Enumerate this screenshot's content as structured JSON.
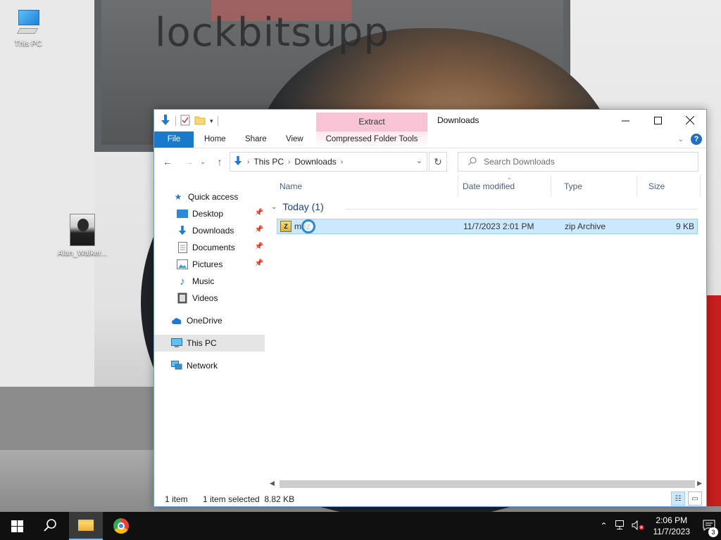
{
  "wallpaper": {
    "overlay_text": "lockbitsupp"
  },
  "desktop": {
    "icons": [
      {
        "label": "This PC"
      },
      {
        "label": "Alan_Walker..."
      }
    ]
  },
  "window": {
    "title": "Downloads",
    "context_tab_group": "Extract",
    "ribbon_tabs": {
      "file": "File",
      "home": "Home",
      "share": "Share",
      "view": "View",
      "context": "Compressed Folder Tools"
    },
    "address": {
      "segments": [
        "This PC",
        "Downloads"
      ]
    },
    "search": {
      "placeholder": "Search Downloads",
      "value": ""
    },
    "nav_pane": {
      "items": [
        {
          "label": "Quick access",
          "icon": "star-icon"
        },
        {
          "label": "Desktop",
          "icon": "desktop-icon",
          "pinned": true
        },
        {
          "label": "Downloads",
          "icon": "download-icon",
          "pinned": true
        },
        {
          "label": "Documents",
          "icon": "document-icon",
          "pinned": true
        },
        {
          "label": "Pictures",
          "icon": "picture-icon",
          "pinned": true
        },
        {
          "label": "Music",
          "icon": "music-icon"
        },
        {
          "label": "Videos",
          "icon": "video-icon"
        },
        {
          "label": "OneDrive",
          "icon": "cloud-icon"
        },
        {
          "label": "This PC",
          "icon": "computer-icon",
          "selected": true
        },
        {
          "label": "Network",
          "icon": "network-icon"
        }
      ]
    },
    "columns": {
      "name": "Name",
      "date": "Date modified",
      "type": "Type",
      "size": "Size"
    },
    "group": {
      "label": "Today (1)"
    },
    "files": [
      {
        "name": "mez",
        "date": "11/7/2023 2:01 PM",
        "type": "zip Archive",
        "size": "9 KB",
        "selected": true
      }
    ],
    "status": {
      "count": "1 item",
      "selection": "1 item selected  8.82 KB"
    }
  },
  "taskbar": {
    "time": "2:06 PM",
    "date": "11/7/2023",
    "notification_count": "3"
  },
  "colors": {
    "accent": "#1979ca",
    "selection": "#cce8ff",
    "context_tab": "#f9c3d6"
  }
}
